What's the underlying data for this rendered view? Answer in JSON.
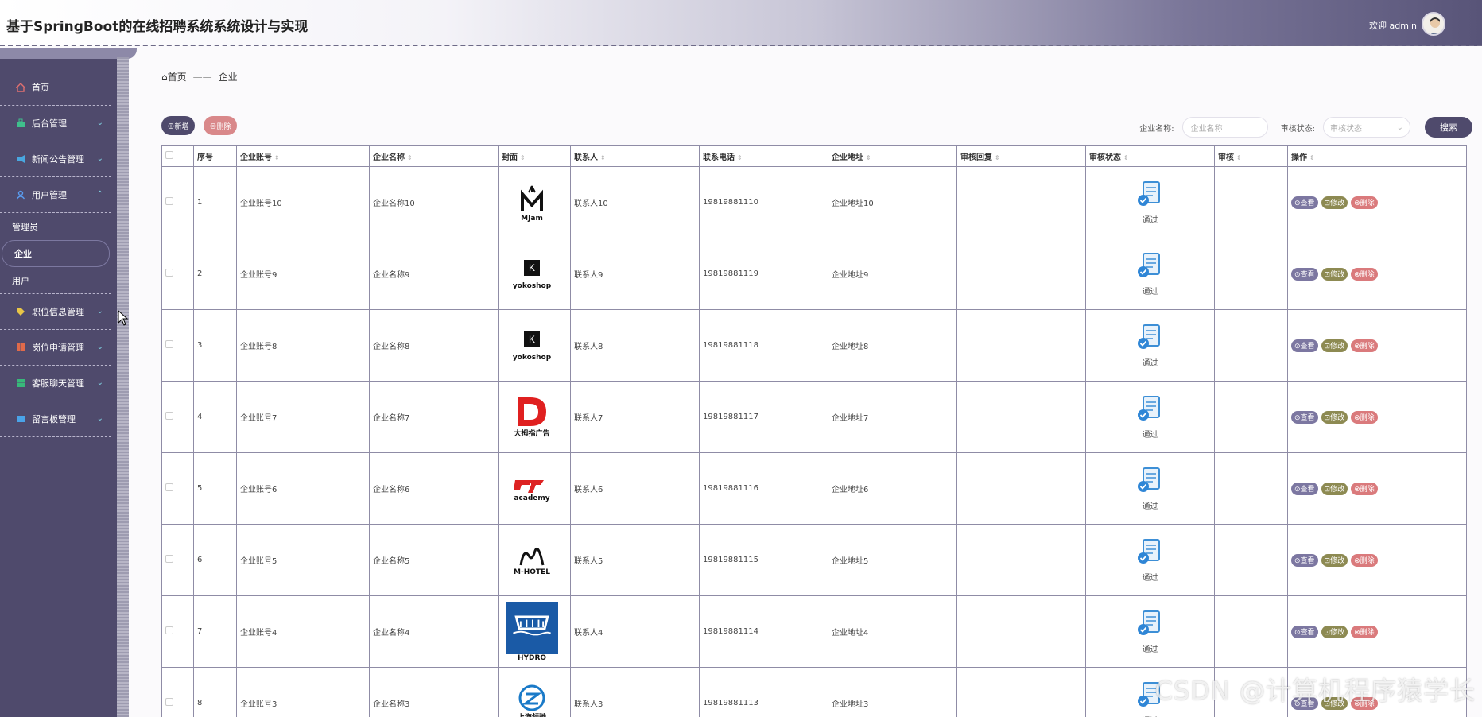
{
  "header": {
    "title": "基于SpringBoot的在线招聘系统系统设计与实现",
    "welcome": "欢迎 admin"
  },
  "sidebar": {
    "items": [
      {
        "label": "首页",
        "icon": "home-icon",
        "color": "#e07070"
      },
      {
        "label": "后台管理",
        "icon": "briefcase-icon",
        "color": "#3fbf8c"
      },
      {
        "label": "新闻公告管理",
        "icon": "megaphone-icon",
        "color": "#49a7e0"
      },
      {
        "label": "用户管理",
        "icon": "user-icon",
        "color": "#5a9cf0"
      },
      {
        "label": "职位信息管理",
        "icon": "tag-icon",
        "color": "#e8c547"
      },
      {
        "label": "岗位申请管理",
        "icon": "book-icon",
        "color": "#e06a4a"
      },
      {
        "label": "客服聊天管理",
        "icon": "chat-icon",
        "color": "#38b87a"
      },
      {
        "label": "留言板管理",
        "icon": "board-icon",
        "color": "#4aa3e8"
      }
    ],
    "user_sub": [
      "管理员",
      "企业",
      "用户"
    ]
  },
  "breadcrumb": {
    "home": "首页",
    "sep": "——",
    "current": "企业"
  },
  "toolbar": {
    "add": "⊕新增",
    "delete": "⊗删除"
  },
  "search": {
    "name_label": "企业名称:",
    "name_placeholder": "企业名称",
    "status_label": "审核状态:",
    "status_placeholder": "审核状态",
    "button": "搜索"
  },
  "table": {
    "headers": [
      "序号",
      "企业账号",
      "企业名称",
      "封面",
      "联系人",
      "联系电话",
      "企业地址",
      "审核回复",
      "审核状态",
      "审核",
      "操作"
    ],
    "rows": [
      {
        "no": "1",
        "account": "企业账号10",
        "name": "企业名称10",
        "logo_text": "MJam",
        "contact": "联系人10",
        "phone": "19819881110",
        "address": "企业地址10",
        "reply": "",
        "status": "通过",
        "audit": ""
      },
      {
        "no": "2",
        "account": "企业账号9",
        "name": "企业名称9",
        "logo_text": "yokoshop",
        "contact": "联系人9",
        "phone": "19819881119",
        "address": "企业地址9",
        "reply": "",
        "status": "通过",
        "audit": ""
      },
      {
        "no": "3",
        "account": "企业账号8",
        "name": "企业名称8",
        "logo_text": "yokoshop",
        "contact": "联系人8",
        "phone": "19819881118",
        "address": "企业地址8",
        "reply": "",
        "status": "通过",
        "audit": ""
      },
      {
        "no": "4",
        "account": "企业账号7",
        "name": "企业名称7",
        "logo_text": "大拇指广告",
        "contact": "联系人7",
        "phone": "19819881117",
        "address": "企业地址7",
        "reply": "",
        "status": "通过",
        "audit": ""
      },
      {
        "no": "5",
        "account": "企业账号6",
        "name": "企业名称6",
        "logo_text": "academy",
        "contact": "联系人6",
        "phone": "19819881116",
        "address": "企业地址6",
        "reply": "",
        "status": "通过",
        "audit": ""
      },
      {
        "no": "6",
        "account": "企业账号5",
        "name": "企业名称5",
        "logo_text": "M-HOTEL",
        "contact": "联系人5",
        "phone": "19819881115",
        "address": "企业地址5",
        "reply": "",
        "status": "通过",
        "audit": ""
      },
      {
        "no": "7",
        "account": "企业账号4",
        "name": "企业名称4",
        "logo_text": "HYDRO",
        "contact": "联系人4",
        "phone": "19819881114",
        "address": "企业地址4",
        "reply": "",
        "status": "通过",
        "audit": ""
      },
      {
        "no": "8",
        "account": "企业账号3",
        "name": "企业名称3",
        "logo_text": "上海领驰",
        "contact": "联系人3",
        "phone": "19819881113",
        "address": "企业地址3",
        "reply": "",
        "status": "通过",
        "audit": ""
      }
    ],
    "actions": {
      "view": "⊙查看",
      "edit": "⊡修改",
      "delete": "⊗删除"
    }
  },
  "watermark": "CSDN @计算机程序猿学长"
}
